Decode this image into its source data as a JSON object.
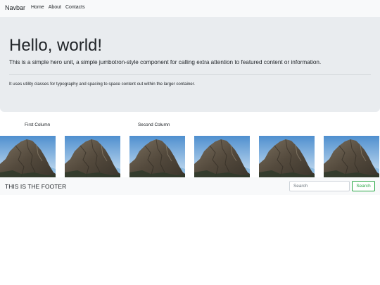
{
  "navbar": {
    "brand": "Navbar",
    "links": [
      "Home",
      "About",
      "Contacts"
    ]
  },
  "hero": {
    "title": "Hello, world!",
    "lead": "This is a simple hero unit, a simple jumbotron-style component for calling extra attention to featured content or information.",
    "text": "It uses utility classes for typography and spacing to space content out within the larger container."
  },
  "columns": {
    "first": "First Column",
    "second": "Second Column"
  },
  "gallery": {
    "image_subject": "rocky mountain peak against blue sky",
    "count": 6
  },
  "footer": {
    "text": "THIS IS THE FOOTER",
    "search_placeholder": "Search",
    "search_button": "Search"
  },
  "colors": {
    "navbar_bg": "#f8f9fa",
    "jumbotron_bg": "#e9ecef",
    "success": "#28a745",
    "sky": "#6aa7d8"
  }
}
